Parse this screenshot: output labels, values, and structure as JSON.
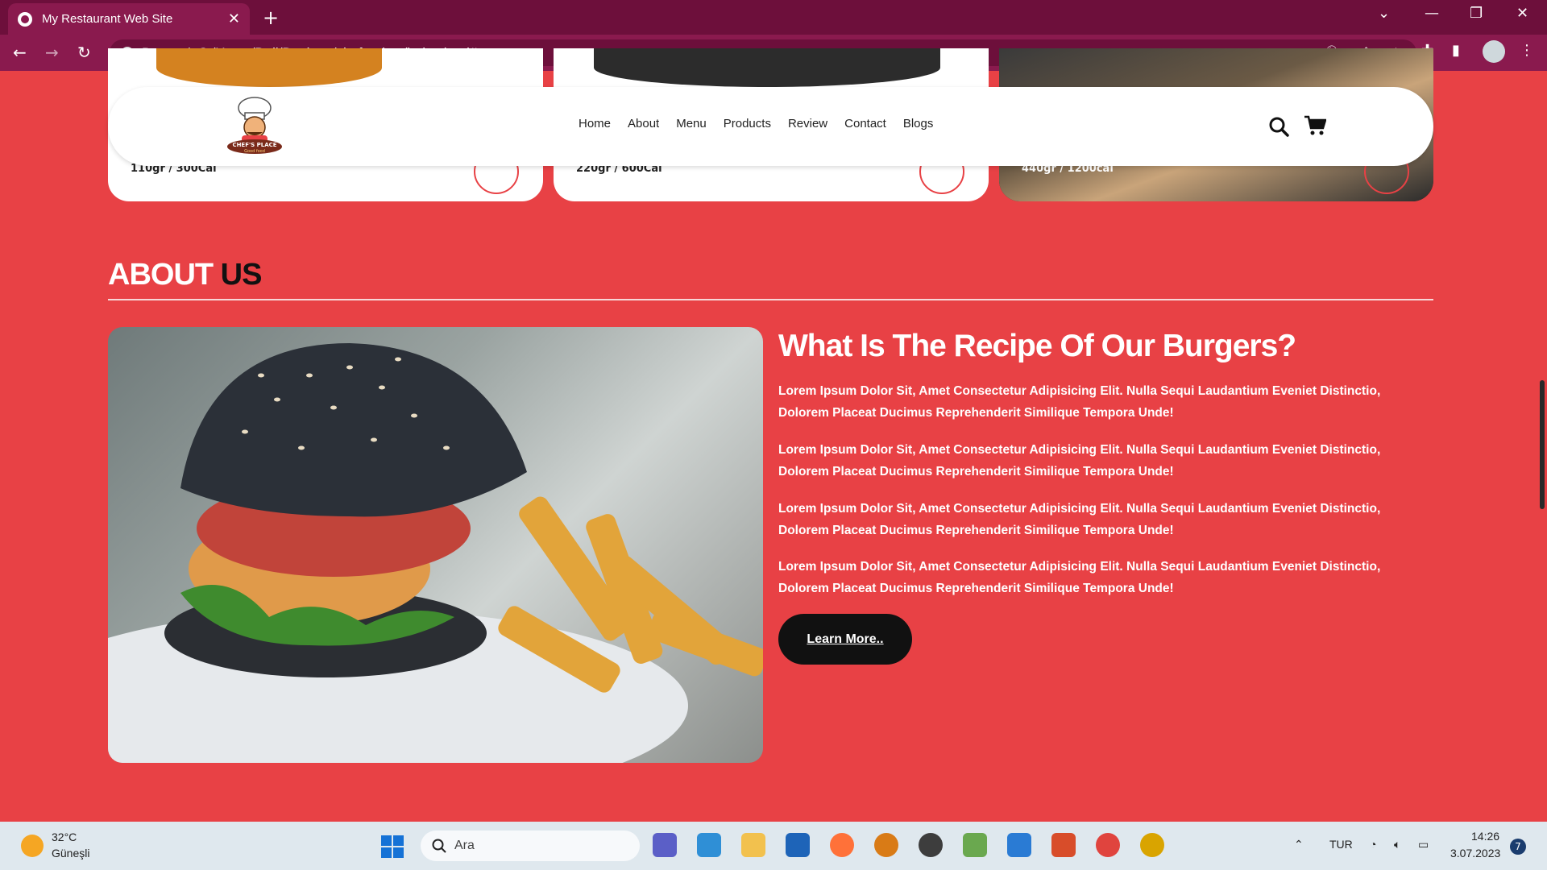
{
  "browser": {
    "tab_title": "My Restaurant Web Site",
    "tab_close": "✕",
    "new_tab": "+",
    "address_label": "Dosya",
    "address_url": "C:/Users/Dell/Desktop/chefproject/index.html#"
  },
  "cards": [
    {
      "calories": "110gr / 300Cal"
    },
    {
      "calories": "220gr / 600Cal"
    },
    {
      "calories": "440gr / 1200cal"
    }
  ],
  "header": {
    "logo_text": "CHEF'S PLACE",
    "logo_sub": "Good food",
    "nav": [
      "Home",
      "About",
      "Menu",
      "Products",
      "Review",
      "Contact",
      "Blogs"
    ]
  },
  "about": {
    "heading_1": "ABOUT",
    "heading_2": "US",
    "title": "What Is The Recipe Of Our Burgers?",
    "paragraphs": [
      "Lorem Ipsum Dolor Sit, Amet Consectetur Adipisicing Elit. Nulla Sequi Laudantium Eveniet Distinctio, Dolorem Placeat Ducimus Reprehenderit Similique Tempora Unde!",
      "Lorem Ipsum Dolor Sit, Amet Consectetur Adipisicing Elit. Nulla Sequi Laudantium Eveniet Distinctio, Dolorem Placeat Ducimus Reprehenderit Similique Tempora Unde!",
      "Lorem Ipsum Dolor Sit, Amet Consectetur Adipisicing Elit. Nulla Sequi Laudantium Eveniet Distinctio, Dolorem Placeat Ducimus Reprehenderit Similique Tempora Unde!",
      "Lorem Ipsum Dolor Sit, Amet Consectetur Adipisicing Elit. Nulla Sequi Laudantium Eveniet Distinctio, Dolorem Placeat Ducimus Reprehenderit Similique Tempora Unde!"
    ],
    "button": "Learn More.."
  },
  "taskbar": {
    "temperature": "32°C",
    "weather": "Güneşli",
    "search_label": "Ara",
    "language": "TUR",
    "time": "14:26",
    "date": "3.07.2023",
    "notifications": "7"
  },
  "colors": {
    "page_bg": "#e84145",
    "browser_dark": "#6d0f3b",
    "browser_toolbar": "#8a1a4e",
    "button_bg": "#111111"
  }
}
